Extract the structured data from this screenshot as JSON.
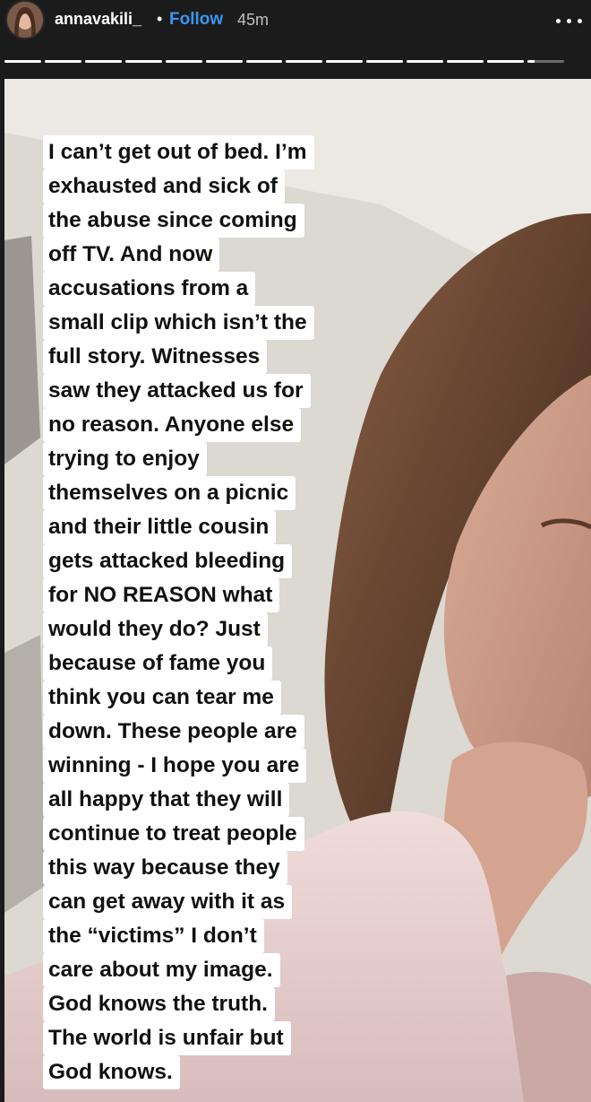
{
  "header": {
    "username": "annavakili_",
    "separator": "•",
    "follow_label": "Follow",
    "time_ago": "45m",
    "more_icon": "more-horizontal-icon"
  },
  "progress": {
    "segment_count": 14,
    "active_segment": 14,
    "active_fill": 0.2
  },
  "story": {
    "caption_lines": [
      "I can’t get out of bed. I’m",
      "exhausted and sick of",
      "the abuse since coming",
      "off TV.  And now",
      "accusations from a",
      "small clip which isn’t the",
      "full story. Witnesses",
      "saw they attacked us for",
      "no reason. Anyone else",
      "trying to enjoy",
      "themselves on a picnic",
      "and their little cousin",
      "gets attacked bleeding",
      "for NO REASON what",
      "would they do? Just",
      "because of fame you",
      "think you can tear me",
      "down. These people are",
      "winning - I hope you are",
      "all happy that they will",
      "continue to treat people",
      "this way because they",
      "can get away with it as",
      "the “victims” I don’t",
      "care about my image.",
      "God knows the truth.",
      "The world is unfair but",
      "God knows."
    ]
  },
  "colors": {
    "background": "#1b1b1b",
    "follow": "#3897f0",
    "caption_bg": "#ffffff",
    "caption_text": "#111111"
  }
}
